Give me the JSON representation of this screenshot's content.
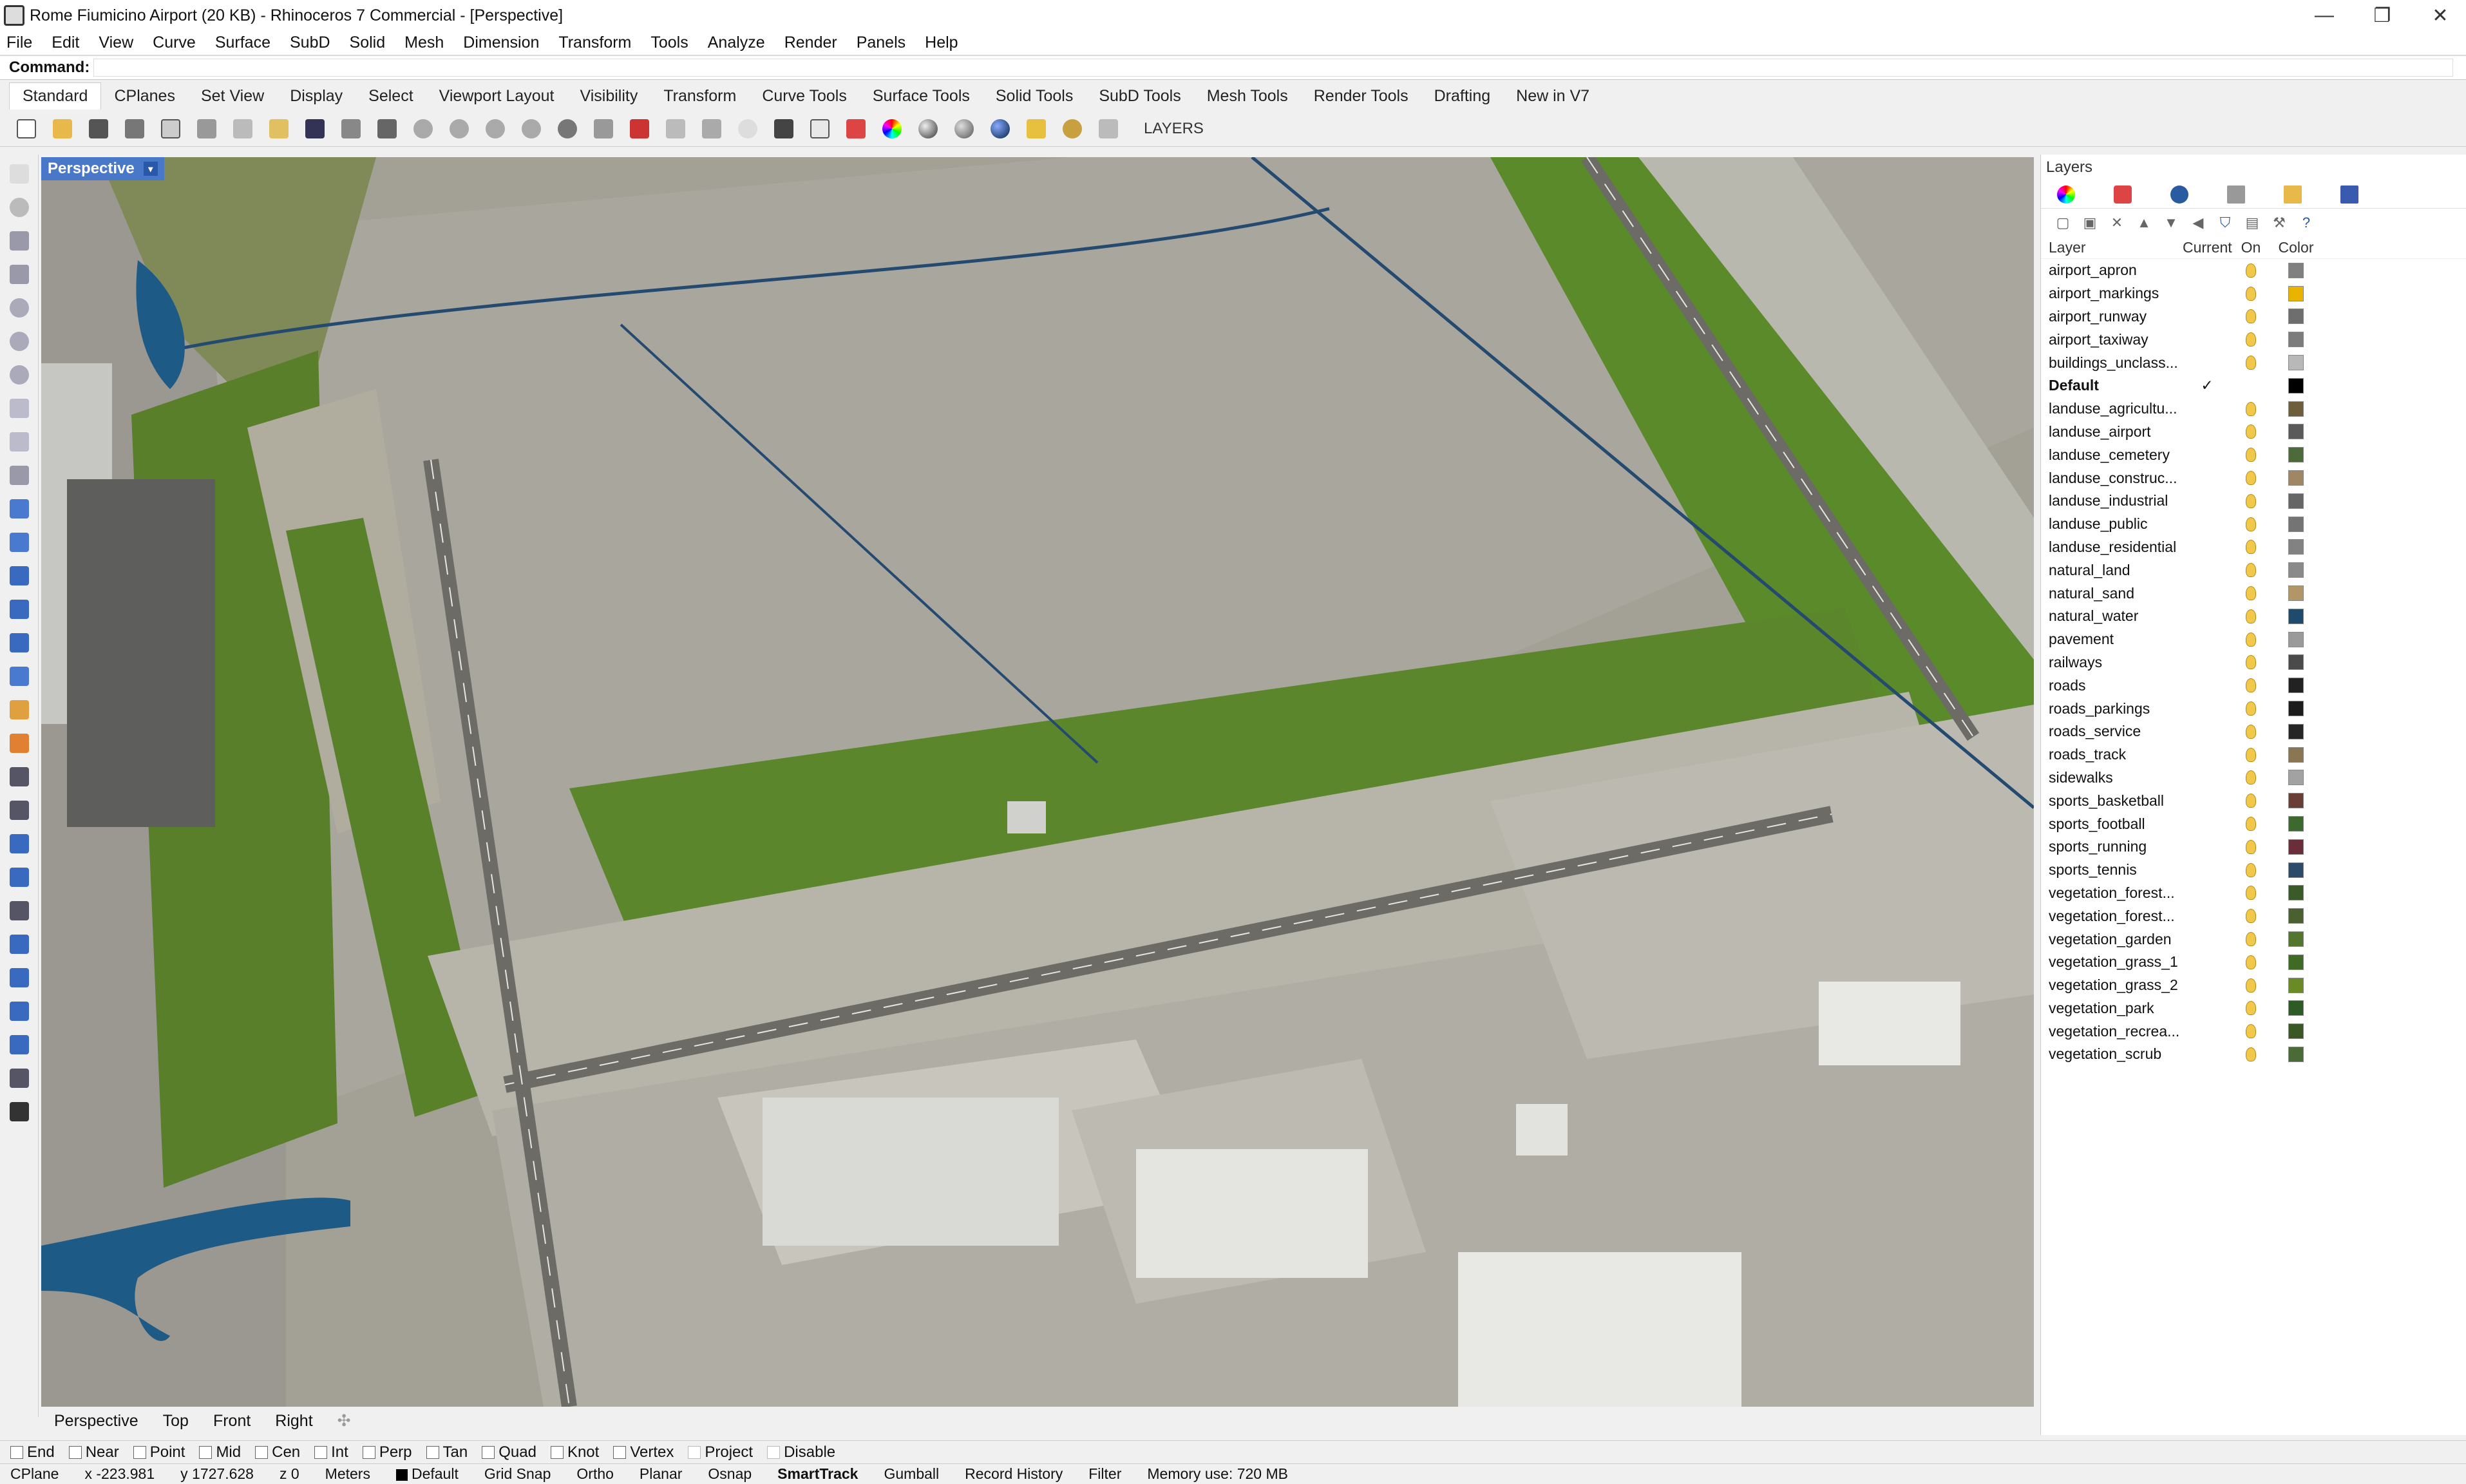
{
  "window": {
    "title": "Rome Fiumicino Airport (20 KB) - Rhinoceros 7 Commercial - [Perspective]",
    "controls": [
      "—",
      "❐",
      "✕"
    ]
  },
  "menu": [
    "File",
    "Edit",
    "View",
    "Curve",
    "Surface",
    "SubD",
    "Solid",
    "Mesh",
    "Dimension",
    "Transform",
    "Tools",
    "Analyze",
    "Render",
    "Panels",
    "Help"
  ],
  "command": {
    "label": "Command:",
    "value": ""
  },
  "toolbar_tabs": [
    "Standard",
    "CPlanes",
    "Set View",
    "Display",
    "Select",
    "Viewport Layout",
    "Visibility",
    "Transform",
    "Curve Tools",
    "Surface Tools",
    "Solid Tools",
    "SubD Tools",
    "Mesh Tools",
    "Render Tools",
    "Drafting",
    "New in V7"
  ],
  "toolbar_icons": [
    "new-icon",
    "open-icon",
    "save-icon",
    "print-icon",
    "import-icon",
    "cut-icon",
    "copy-icon",
    "paste-icon",
    "undo-icon",
    "pan-icon",
    "move-icon",
    "zoom-window-icon",
    "zoom-dynamic-icon",
    "zoom-extents-icon",
    "zoom-selected-icon",
    "rotate-view-icon",
    "four-viewports-icon",
    "car-icon",
    "plane-icon",
    "dimension-icon",
    "light-icon",
    "lock-icon",
    "select-icon",
    "layer-icon",
    "color-wheel-icon",
    "sphere-shaded-icon",
    "sphere-ghost-icon",
    "sphere-render-icon",
    "spotlight-icon",
    "settings-icon",
    "grid-snap-icon"
  ],
  "toolbar_layers_label": "LAYERS",
  "viewport": {
    "label": "Perspective"
  },
  "view_tabs": [
    "Perspective",
    "Top",
    "Front",
    "Right"
  ],
  "osnaps": [
    "End",
    "Near",
    "Point",
    "Mid",
    "Cen",
    "Int",
    "Perp",
    "Tan",
    "Quad",
    "Knot",
    "Vertex",
    "Project",
    "Disable"
  ],
  "status": {
    "cplane": "CPlane",
    "x": "x -223.981",
    "y": "y 1727.628",
    "z": "z 0",
    "units": "Meters",
    "layer": "Default",
    "grid_snap": "Grid Snap",
    "ortho": "Ortho",
    "planar": "Planar",
    "osnap": "Osnap",
    "smarttrack": "SmartTrack",
    "gumball": "Gumball",
    "record_history": "Record History",
    "filter": "Filter",
    "memory": "Memory use: 720 MB"
  },
  "layers_panel": {
    "title": "Layers",
    "headers": {
      "layer": "Layer",
      "current": "Current",
      "on": "On",
      "color": "Color"
    },
    "rows": [
      {
        "name": "airport_apron",
        "current": "",
        "color": "#808080"
      },
      {
        "name": "airport_markings",
        "current": "",
        "color": "#e8b400"
      },
      {
        "name": "airport_runway",
        "current": "",
        "color": "#6e6e6e"
      },
      {
        "name": "airport_taxiway",
        "current": "",
        "color": "#7c7c7c"
      },
      {
        "name": "buildings_unclass...",
        "current": "",
        "color": "#b8b8b8"
      },
      {
        "name": "Default",
        "current": "✓",
        "color": "#000000"
      },
      {
        "name": "landuse_agricultu...",
        "current": "",
        "color": "#6d5f3c"
      },
      {
        "name": "landuse_airport",
        "current": "",
        "color": "#5a5a5a"
      },
      {
        "name": "landuse_cemetery",
        "current": "",
        "color": "#4d6b3a"
      },
      {
        "name": "landuse_construc...",
        "current": "",
        "color": "#a08763"
      },
      {
        "name": "landuse_industrial",
        "current": "",
        "color": "#666666"
      },
      {
        "name": "landuse_public",
        "current": "",
        "color": "#747474"
      },
      {
        "name": "landuse_residential",
        "current": "",
        "color": "#828282"
      },
      {
        "name": "natural_land",
        "current": "",
        "color": "#8a8a8a"
      },
      {
        "name": "natural_sand",
        "current": "",
        "color": "#b29668"
      },
      {
        "name": "natural_water",
        "current": "",
        "color": "#1e4a6e"
      },
      {
        "name": "pavement",
        "current": "",
        "color": "#9a9a9a"
      },
      {
        "name": "railways",
        "current": "",
        "color": "#4a4a4a"
      },
      {
        "name": "roads",
        "current": "",
        "color": "#222222"
      },
      {
        "name": "roads_parkings",
        "current": "",
        "color": "#1c1c1c"
      },
      {
        "name": "roads_service",
        "current": "",
        "color": "#262626"
      },
      {
        "name": "roads_track",
        "current": "",
        "color": "#8a7650"
      },
      {
        "name": "sidewalks",
        "current": "",
        "color": "#a2a2a2"
      },
      {
        "name": "sports_basketball",
        "current": "",
        "color": "#6a3e36"
      },
      {
        "name": "sports_football",
        "current": "",
        "color": "#3c6a2e"
      },
      {
        "name": "sports_running",
        "current": "",
        "color": "#6a2e3a"
      },
      {
        "name": "sports_tennis",
        "current": "",
        "color": "#2e4a6a"
      },
      {
        "name": "vegetation_forest...",
        "current": "",
        "color": "#3a5a2a"
      },
      {
        "name": "vegetation_forest...",
        "current": "",
        "color": "#4a6030"
      },
      {
        "name": "vegetation_garden",
        "current": "",
        "color": "#52762e"
      },
      {
        "name": "vegetation_grass_1",
        "current": "",
        "color": "#3f6a26"
      },
      {
        "name": "vegetation_grass_2",
        "current": "",
        "color": "#6a8a26"
      },
      {
        "name": "vegetation_park",
        "current": "",
        "color": "#2e5a26"
      },
      {
        "name": "vegetation_recrea...",
        "current": "",
        "color": "#3a5826"
      },
      {
        "name": "vegetation_scrub",
        "current": "",
        "color": "#4a6a36"
      }
    ]
  }
}
